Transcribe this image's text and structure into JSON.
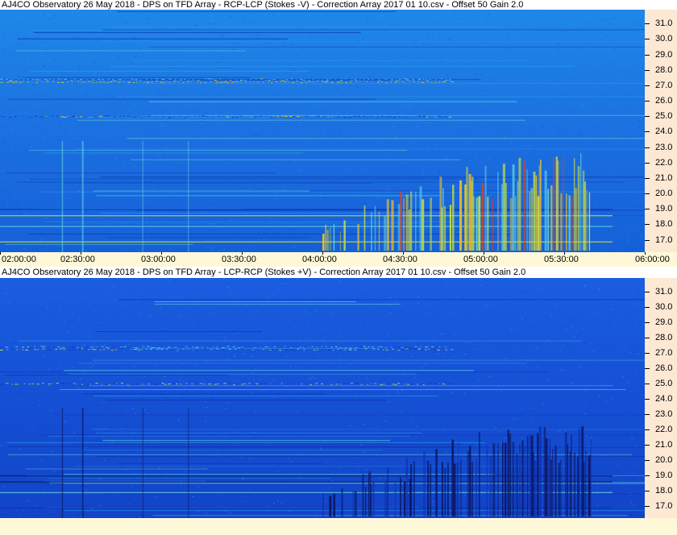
{
  "chart_data": [
    {
      "type": "heatmap",
      "title": "AJ4CO Observatory 26 May 2018  -  DPS on TFD Array  -  RCP-LCP (Stokes -V)  -  Correction Array 2017 01 10.csv  -  Offset 50  Gain 2.0",
      "y_ticks": [
        "31.0",
        "30.0",
        "29.0",
        "28.0",
        "27.0",
        "26.0",
        "25.0",
        "24.0",
        "23.0",
        "22.0",
        "21.0",
        "20.0",
        "19.0",
        "18.0",
        "17.0"
      ],
      "ylim": [
        16.2,
        31.9
      ],
      "xlim": [
        "02:00:00",
        "06:00:00"
      ],
      "burst_time_range": [
        "04:00:00",
        "05:40:00"
      ],
      "burst_freq_range": [
        16.3,
        22.7
      ],
      "burst_polarity": "dark",
      "palette": [
        "#0a1560",
        "#1030b0",
        "#1450d8",
        "#1a6ee8",
        "#2a9af0",
        "#60d0e0",
        "#c8e040",
        "#f0c020",
        "#e04020"
      ]
    },
    {
      "type": "heatmap",
      "title": "AJ4CO Observatory 26 May 2018  -  DPS on TFD Array  -  LCP-RCP (Stokes +V)  -  Correction Array 2017 01 10.csv  -  Offset 50  Gain 2.0",
      "y_ticks": [
        "31.0",
        "30.0",
        "29.0",
        "28.0",
        "27.0",
        "26.0",
        "25.0",
        "24.0",
        "23.0",
        "22.0",
        "21.0",
        "20.0",
        "19.0",
        "18.0",
        "17.0"
      ],
      "ylim": [
        16.2,
        31.9
      ],
      "xlim": [
        "02:00:00",
        "06:00:00"
      ],
      "burst_time_range": [
        "04:00:00",
        "05:40:00"
      ],
      "burst_freq_range": [
        16.3,
        22.7
      ],
      "burst_polarity": "bright",
      "palette": [
        "#0a1560",
        "#1030b0",
        "#1450d8",
        "#1a6ee8",
        "#2a9af0",
        "#60d0e0",
        "#c8e040",
        "#f0c020",
        "#e04020"
      ]
    }
  ],
  "time_axis": {
    "labels": [
      "02:00:00",
      "02:30:00",
      "03:00:00",
      "03:30:00",
      "04:00:00",
      "04:30:00",
      "05:00:00",
      "05:30:00",
      "06:00:00"
    ]
  },
  "colors": {
    "axis_bg": "#fde8d4",
    "timebar_bg": "#fff8d8"
  }
}
